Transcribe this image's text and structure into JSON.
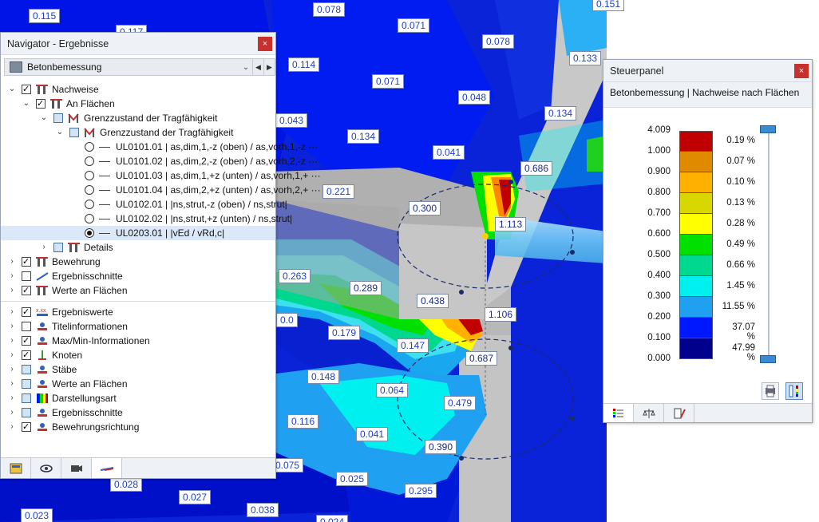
{
  "viewport_labels": [
    "0.115",
    "0.117",
    "0.078",
    "0.151",
    "0.071",
    "0.078",
    "0.114",
    "0.133",
    "0.071",
    "0.048",
    "0.134",
    "0.043",
    "0.134",
    "0.041",
    "0.686",
    "0.221",
    "0.300",
    "1.113",
    "0.263",
    "0.289",
    "0.438",
    "1.106",
    "0.0",
    "0.179",
    "0.147",
    "0.687",
    "0.148",
    "0.064",
    "0.479",
    "0.116",
    "0.041",
    "0.390",
    "0.075",
    "0.025",
    "0.028",
    "0.027",
    "0.295",
    "0.023",
    "0.038",
    "0.024"
  ],
  "navigator": {
    "title": "Navigator - Ergebnisse",
    "close_label": "×",
    "combo": {
      "value": "Betonbemessung",
      "arrow": "⌄",
      "prev": "◀",
      "next": "▶"
    },
    "tree": [
      {
        "label": "Nachweise"
      },
      {
        "label": "An Flächen"
      },
      {
        "label": "Grenzzustand der Tragfähigkeit"
      },
      {
        "label": "Grenzzustand der Tragfähigkeit"
      },
      {
        "label": "UL0101.01 | as,dim,1,-z (oben) / as,vorh,1,-z ···"
      },
      {
        "label": "UL0101.02 | as,dim,2,-z (oben) / as,vorh,2,-z ···"
      },
      {
        "label": "UL0101.03 | as,dim,1,+z (unten) / as,vorh,1,+ ···"
      },
      {
        "label": "UL0101.04 | as,dim,2,+z (unten) / as,vorh,2,+ ···"
      },
      {
        "label": "UL0102.01 | |ns,strut,-z (oben) / ns,strut|"
      },
      {
        "label": "UL0102.02 | |ns,strut,+z (unten) / ns,strut|"
      },
      {
        "label": "UL0203.01 | |vEd / vRd,c|"
      },
      {
        "label": "Details"
      },
      {
        "label": "Bewehrung"
      },
      {
        "label": "Ergebnisschnitte"
      },
      {
        "label": "Werte an Flächen"
      },
      {
        "label": "Ergebniswerte"
      },
      {
        "label": "Titelinformationen"
      },
      {
        "label": "Max/Min-Informationen"
      },
      {
        "label": "Knoten"
      },
      {
        "label": "Stäbe"
      },
      {
        "label": "Werte an Flächen"
      },
      {
        "label": "Darstellungsart"
      },
      {
        "label": "Ergebnisschnitte"
      },
      {
        "label": "Bewehrungsrichtung"
      }
    ],
    "tabs": [
      "data-icon",
      "eye-icon",
      "camera-icon",
      "results-icon"
    ]
  },
  "steuerpanel": {
    "title": "Steuerpanel",
    "close_label": "×",
    "subtitle": "Betonbemessung | Nachweise nach Flächen",
    "scale_values": [
      "4.009",
      "1.000",
      "0.900",
      "0.800",
      "0.700",
      "0.600",
      "0.500",
      "0.400",
      "0.300",
      "0.200",
      "0.100",
      "0.000"
    ],
    "legend": [
      {
        "color": "#c00000",
        "percent": "0.19 %"
      },
      {
        "color": "#e08a00",
        "percent": "0.07 %"
      },
      {
        "color": "#ffb000",
        "percent": "0.10 %"
      },
      {
        "color": "#d8d800",
        "percent": "0.13 %"
      },
      {
        "color": "#ffff00",
        "percent": "0.28 %"
      },
      {
        "color": "#00e000",
        "percent": "0.49 %"
      },
      {
        "color": "#00d890",
        "percent": "0.66 %"
      },
      {
        "color": "#00f0f0",
        "percent": "1.45 %"
      },
      {
        "color": "#1fa0f0",
        "percent": "11.55 %"
      },
      {
        "color": "#0018ff",
        "percent": "37.07 %"
      },
      {
        "color": "#00008c",
        "percent": "47.99 %"
      }
    ],
    "tabs": [
      "legend-icon",
      "balance-icon",
      "settings-icon"
    ]
  }
}
